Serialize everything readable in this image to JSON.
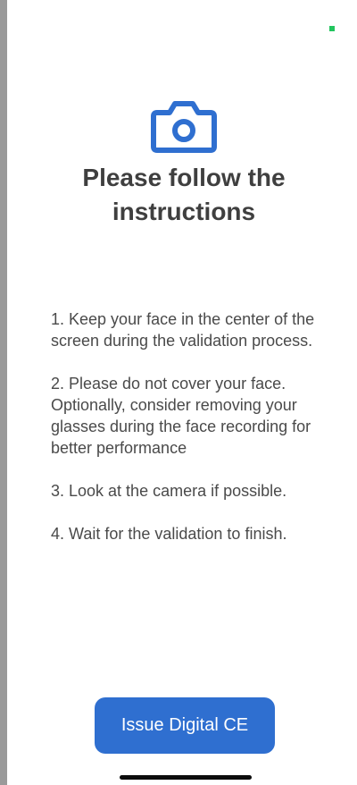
{
  "header": {
    "title": "Please follow the instructions",
    "icon": "camera-icon"
  },
  "instructions": [
    "1. Keep your face in the center of the screen during the validation process.",
    "2. Please do not cover your face. Optionally, consider removing your glasses during the face recording for better performance",
    "3. Look at the camera if possible.",
    "4. Wait for the validation to finish."
  ],
  "footer": {
    "button_label": "Issue Digital CE"
  },
  "colors": {
    "accent": "#2f6fd0",
    "text": "#4a4a4a",
    "title": "#3f3f3f",
    "status": "#22c55e"
  }
}
